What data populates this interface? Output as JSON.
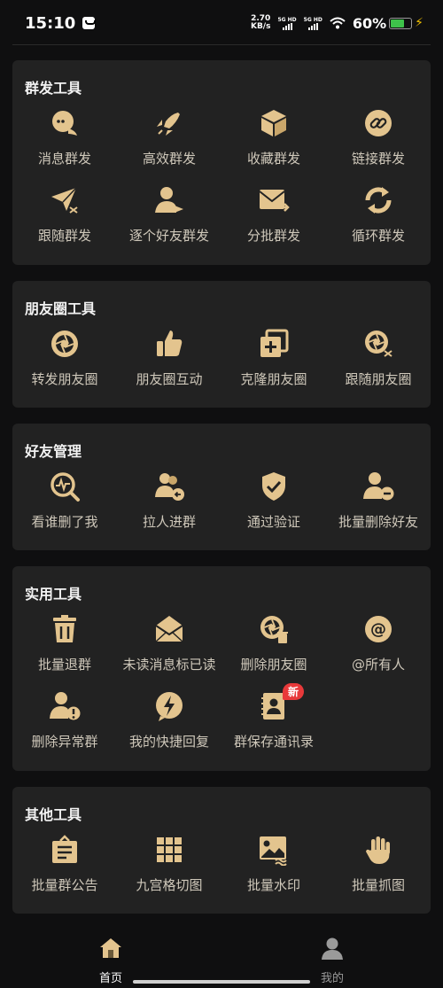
{
  "status": {
    "time": "15:10",
    "speed_value": "2.70",
    "speed_unit": "KB/s",
    "sig1": "5G HD",
    "sig2": "5G HD",
    "battery": "60%"
  },
  "colors": {
    "icon_gold": "#e3c48e",
    "card_bg": "#222222",
    "page_bg": "#0f0f10",
    "badge_red": "#e8393a",
    "active_tab": "#ffffff",
    "inactive_tab": "#9a9a9a"
  },
  "sections": [
    {
      "title": "群发工具",
      "items": [
        {
          "label": "消息群发",
          "icon": "chat-bubbles-icon"
        },
        {
          "label": "高效群发",
          "icon": "rocket-icon"
        },
        {
          "label": "收藏群发",
          "icon": "cube-icon"
        },
        {
          "label": "链接群发",
          "icon": "link-icon"
        },
        {
          "label": "跟随群发",
          "icon": "paper-plane-shuffle-icon"
        },
        {
          "label": "逐个好友群发",
          "icon": "user-send-icon"
        },
        {
          "label": "分批群发",
          "icon": "envelope-arrow-icon"
        },
        {
          "label": "循环群发",
          "icon": "cycle-arrows-icon"
        }
      ]
    },
    {
      "title": "朋友圈工具",
      "items": [
        {
          "label": "转发朋友圈",
          "icon": "aperture-icon"
        },
        {
          "label": "朋友圈互动",
          "icon": "thumbs-up-icon"
        },
        {
          "label": "克隆朋友圈",
          "icon": "clone-plus-icon"
        },
        {
          "label": "跟随朋友圈",
          "icon": "aperture-shuffle-icon"
        }
      ]
    },
    {
      "title": "好友管理",
      "items": [
        {
          "label": "看谁删了我",
          "icon": "search-pulse-icon"
        },
        {
          "label": "拉人进群",
          "icon": "users-add-icon"
        },
        {
          "label": "通过验证",
          "icon": "shield-check-icon"
        },
        {
          "label": "批量删除好友",
          "icon": "user-minus-icon"
        }
      ]
    },
    {
      "title": "实用工具",
      "items": [
        {
          "label": "批量退群",
          "icon": "trash-icon"
        },
        {
          "label": "未读消息标已读",
          "icon": "open-envelope-icon"
        },
        {
          "label": "删除朋友圈",
          "icon": "aperture-delete-icon"
        },
        {
          "label": "@所有人",
          "icon": "at-sign-icon"
        },
        {
          "label": "删除异常群",
          "icon": "user-warning-icon"
        },
        {
          "label": "我的快捷回复",
          "icon": "lightning-icon"
        },
        {
          "label": "群保存通讯录",
          "icon": "contacts-book-icon",
          "badge": "新"
        }
      ]
    },
    {
      "title": "其他工具",
      "items": [
        {
          "label": "批量群公告",
          "icon": "notice-board-icon"
        },
        {
          "label": "九宫格切图",
          "icon": "nine-grid-icon"
        },
        {
          "label": "批量水印",
          "icon": "image-watermark-icon"
        },
        {
          "label": "批量抓图",
          "icon": "grab-hand-icon"
        }
      ]
    }
  ],
  "tabbar": {
    "home_label": "首页",
    "mine_label": "我的"
  }
}
